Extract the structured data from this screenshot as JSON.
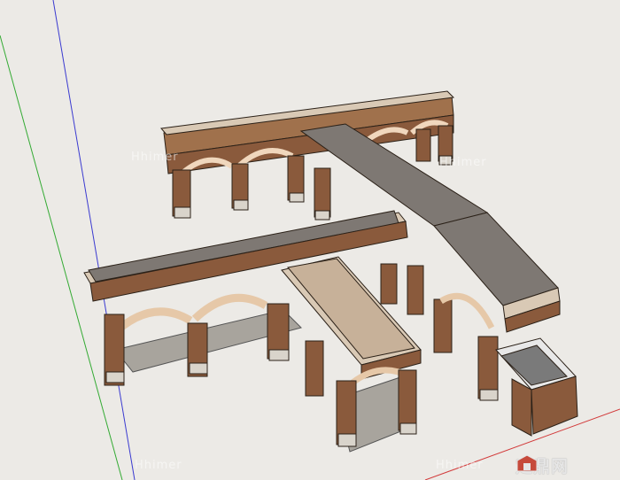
{
  "watermarks": [
    "Hhimer",
    "Hhimer",
    "Hhimer",
    "Hhimer"
  ],
  "logo": {
    "text": "定鼎网",
    "icon": "logo-icon"
  },
  "colors": {
    "background": "#eceae6",
    "brick": "#8a5a3c",
    "roof": "#7e7873",
    "stone": "#e6c8a8",
    "axis_red": "#d23a3a",
    "axis_green": "#33aa33",
    "axis_blue": "#3a3ad0"
  }
}
